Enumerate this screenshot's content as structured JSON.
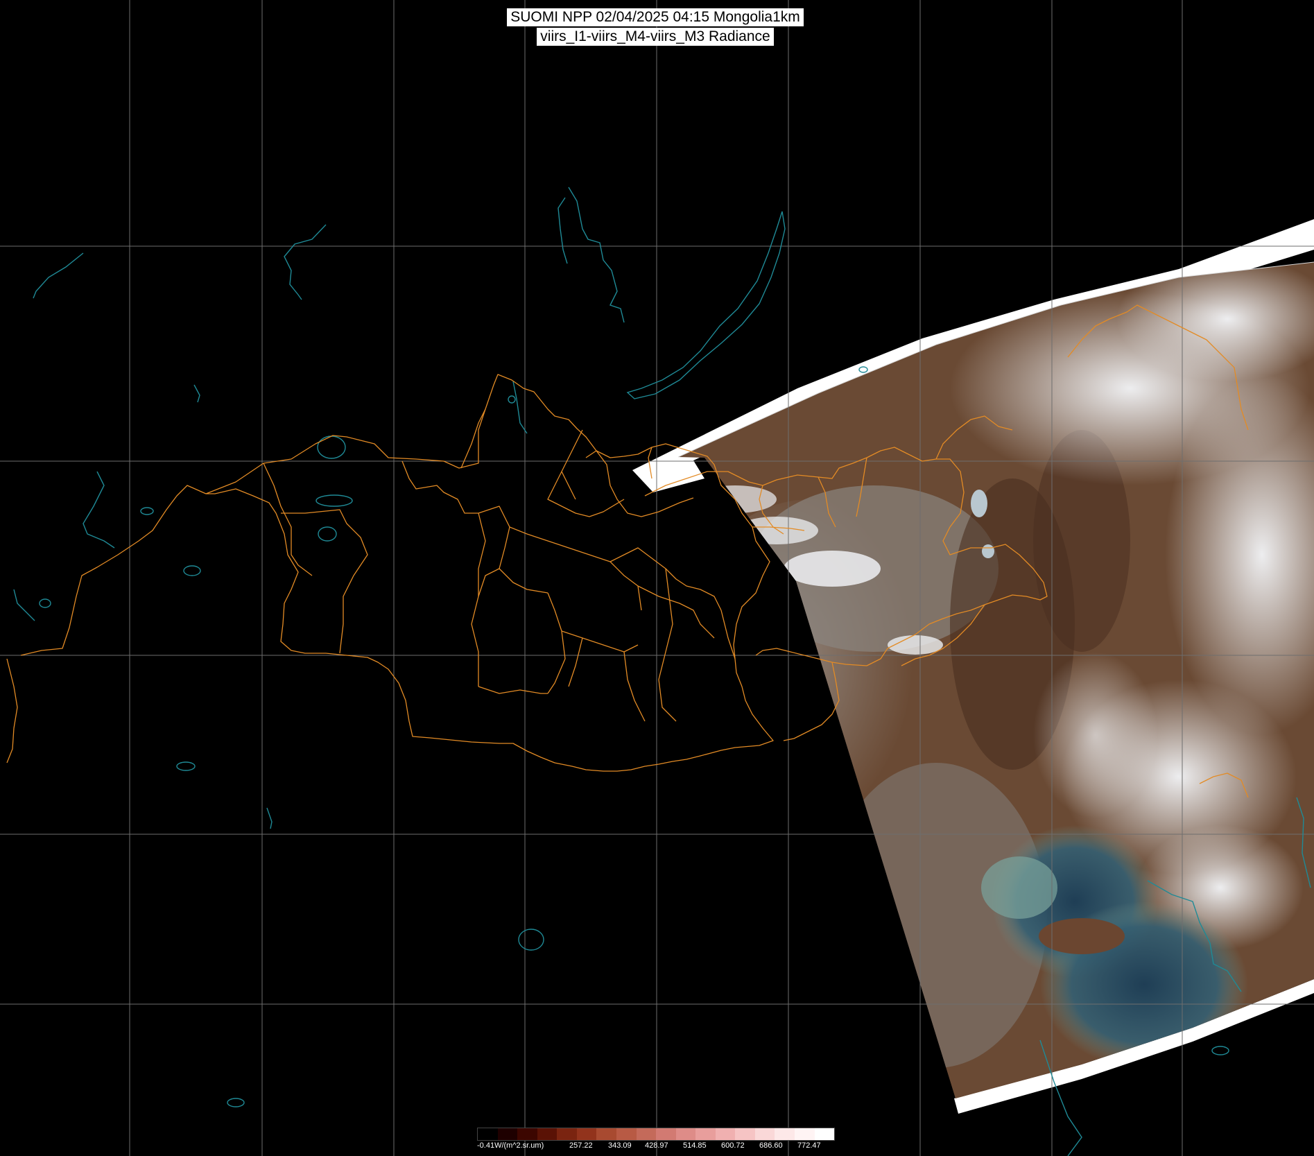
{
  "header": {
    "title_line1": "SUOMI NPP 02/04/2025 04:15 Mongolia1km",
    "title_line2": "viirs_I1-viirs_M4-viirs_M3 Radiance"
  },
  "colorbar": {
    "unit_label": "-0.41W/(m^2.sr.um)",
    "ticks": [
      "257.22",
      "343.09",
      "428.97",
      "514.85",
      "600.72",
      "686.60",
      "772.47"
    ],
    "colors": [
      "#000000",
      "#1e0000",
      "#3c0600",
      "#5a1205",
      "#7a2410",
      "#92331c",
      "#a84a30",
      "#b85a44",
      "#c46a5a",
      "#d27a72",
      "#de8c88",
      "#e89e9c",
      "#f0b0b0",
      "#f6c4c4",
      "#fad8d8",
      "#fde8e8",
      "#fff4f4",
      "#ffffff"
    ]
  },
  "map": {
    "graticule_color": "#6e6e6e",
    "border_color": "#e38b25",
    "water_color": "#1f8a96",
    "swath_colors": {
      "land_brown": "#6e4a32",
      "land_gray": "#8f8a86",
      "cloud_white": "#e6e9ee",
      "sea_blue": "#2e4f6a",
      "sea_sediment": "#7b9a95",
      "no_data_edge": "#ffffff"
    }
  }
}
